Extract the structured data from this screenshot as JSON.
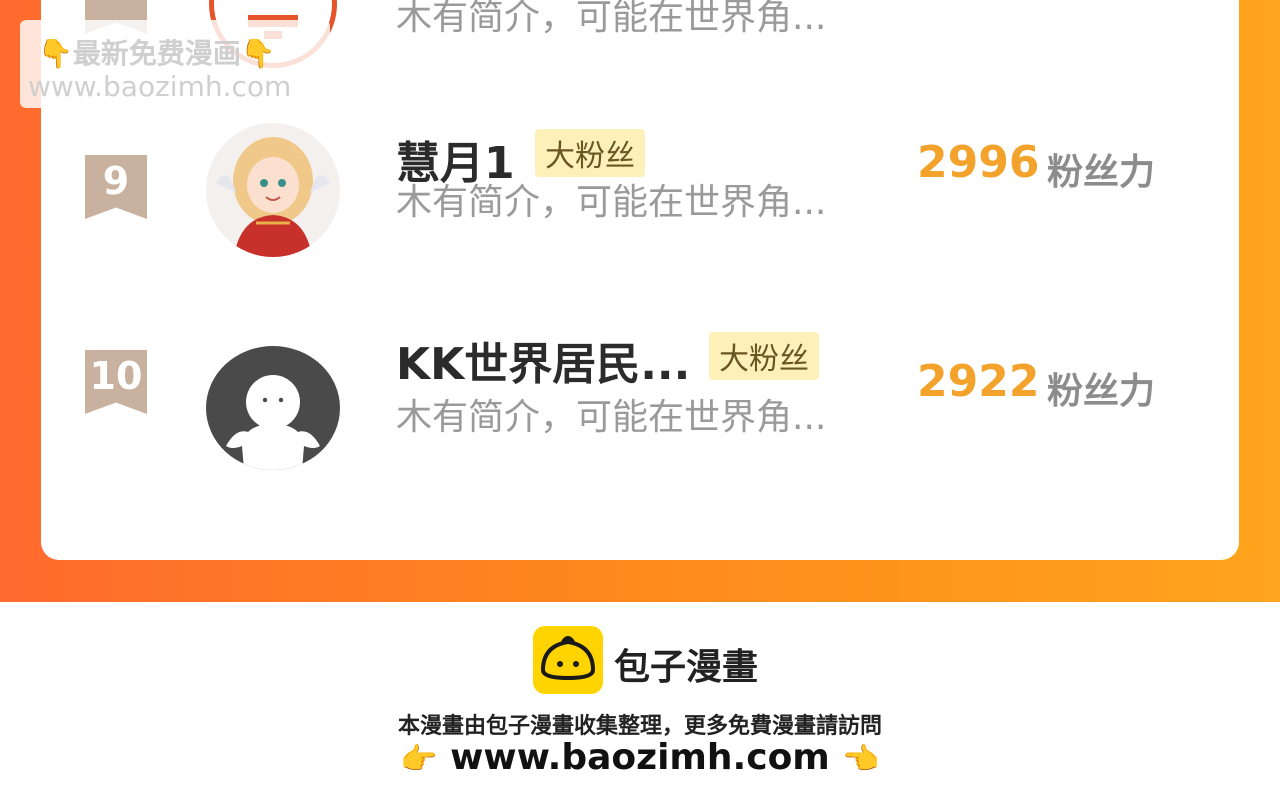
{
  "colors": {
    "banner_start": "#ff6a2e",
    "banner_end": "#ffa41c",
    "score": "#f3a22c",
    "badge_bg": "#fdf1b9",
    "rank_flag": "#c8b29f",
    "logo_yellow": "#ffd400"
  },
  "watermark": {
    "line1": "👇最新免费漫画👇",
    "line2": "www.baozimh.com"
  },
  "fans": [
    {
      "rank": "",
      "name": "",
      "badge": "",
      "intro": "木有简介，可能在世界角...",
      "score": "",
      "unit": "",
      "avatar_icon": "avatar-icon"
    },
    {
      "rank": "9",
      "name": "慧月1",
      "badge": "大粉丝",
      "intro": "木有简介，可能在世界角...",
      "score": "2996",
      "unit": "粉丝力",
      "avatar_icon": "anime-girl-avatar-icon"
    },
    {
      "rank": "10",
      "name": "KK世界居民...",
      "badge": "大粉丝",
      "intro": "木有简介，可能在世界角...",
      "score": "2922",
      "unit": "粉丝力",
      "avatar_icon": "default-user-avatar-icon"
    }
  ],
  "footer": {
    "brand": "包子漫畫",
    "note": "本漫畫由包子漫畫收集整理，更多免費漫畫請訪問",
    "url": "www.baozimh.com",
    "left_hand": "👉",
    "right_hand": "👈",
    "logo_icon": "baozi-logo-icon"
  }
}
